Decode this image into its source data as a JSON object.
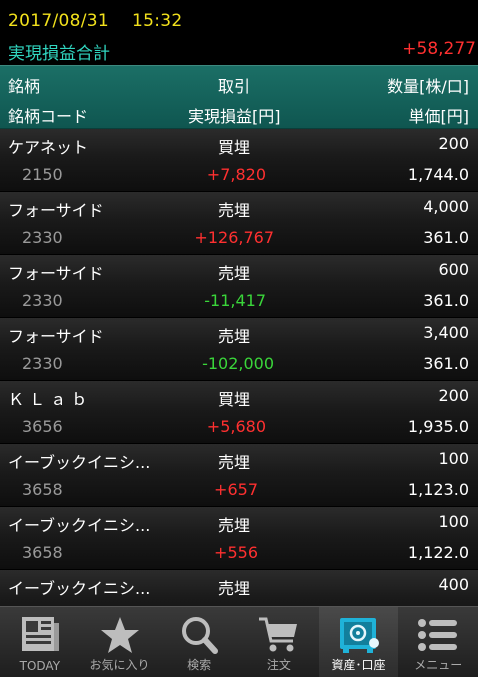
{
  "status": {
    "datetime": "2017/08/31　 15:32",
    "realized_pl_label": "実現損益合計",
    "realized_pl_total": "+58,277"
  },
  "table_header": {
    "col_name": "銘柄",
    "col_trade": "取引",
    "col_qty": "数量[株/口]",
    "col_code": "銘柄コード",
    "col_pl": "実現損益[円]",
    "col_price": "単価[円]"
  },
  "rows": [
    {
      "name": "ケアネット",
      "trade": "買埋",
      "qty": "200",
      "code": "2150",
      "pl": "+7,820",
      "pl_sign": "pos",
      "price": "1,744.0"
    },
    {
      "name": "フォーサイド",
      "trade": "売埋",
      "qty": "4,000",
      "code": "2330",
      "pl": "+126,767",
      "pl_sign": "pos",
      "price": "361.0"
    },
    {
      "name": "フォーサイド",
      "trade": "売埋",
      "qty": "600",
      "code": "2330",
      "pl": "-11,417",
      "pl_sign": "neg",
      "price": "361.0"
    },
    {
      "name": "フォーサイド",
      "trade": "売埋",
      "qty": "3,400",
      "code": "2330",
      "pl": "-102,000",
      "pl_sign": "neg",
      "price": "361.0"
    },
    {
      "name": "Ｋ Ｌ ａ ｂ",
      "trade": "買埋",
      "qty": "200",
      "code": "3656",
      "pl": "+5,680",
      "pl_sign": "pos",
      "price": "1,935.0"
    },
    {
      "name": "イーブックイニシ...",
      "trade": "売埋",
      "qty": "100",
      "code": "3658",
      "pl": "+657",
      "pl_sign": "pos",
      "price": "1,123.0"
    },
    {
      "name": "イーブックイニシ...",
      "trade": "売埋",
      "qty": "100",
      "code": "3658",
      "pl": "+556",
      "pl_sign": "pos",
      "price": "1,122.0"
    },
    {
      "name": "イーブックイニシ...",
      "trade": "売埋",
      "qty": "400",
      "code": "",
      "pl": "",
      "pl_sign": "pos",
      "price": ""
    }
  ],
  "tabs": [
    {
      "label": "TODAY",
      "icon": "newspaper-icon",
      "active": false
    },
    {
      "label": "お気に入り",
      "icon": "star-icon",
      "active": false
    },
    {
      "label": "検索",
      "icon": "search-icon",
      "active": false
    },
    {
      "label": "注文",
      "icon": "cart-icon",
      "active": false
    },
    {
      "label": "資産･口座",
      "icon": "safe-icon",
      "active": true
    },
    {
      "label": "メニュー",
      "icon": "menu-icon",
      "active": false
    }
  ],
  "colors": {
    "datetime": "#f2e11c",
    "label_teal": "#31d6c0",
    "profit": "#ff3030",
    "loss": "#3ad63a",
    "header_bg": "#1b6f66"
  }
}
